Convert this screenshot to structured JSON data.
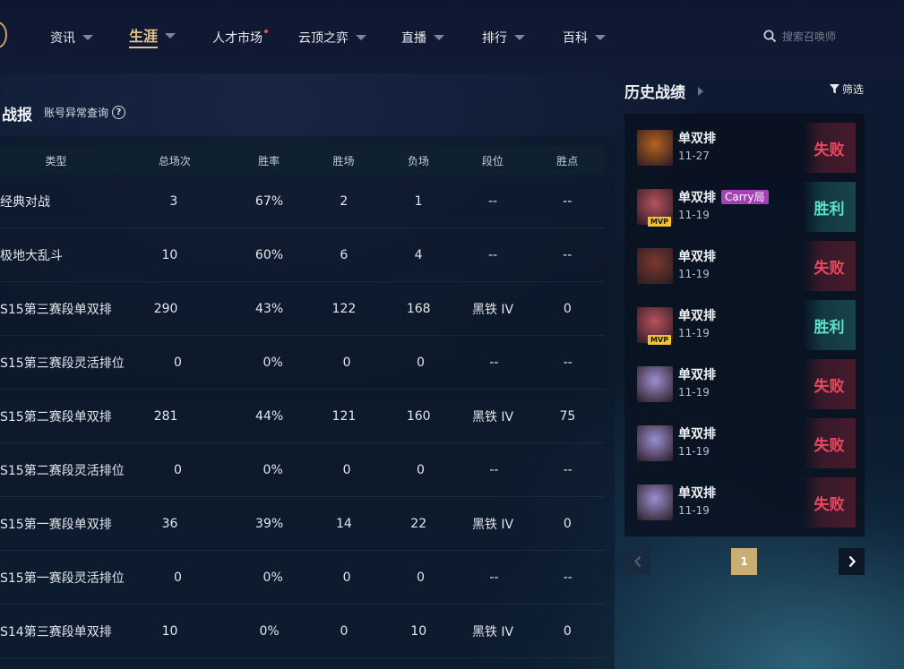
{
  "nav": {
    "items": [
      {
        "label": "资讯",
        "caret": true
      },
      {
        "label": "生涯",
        "caret": true,
        "active": true
      },
      {
        "label": "人才市场",
        "dot": true
      },
      {
        "label": "云顶之弈",
        "caret": true
      },
      {
        "label": "直播",
        "caret": true
      },
      {
        "label": "排行",
        "caret": true
      },
      {
        "label": "百科",
        "caret": true
      }
    ],
    "search_placeholder": "搜索召唤师"
  },
  "stats": {
    "title": "战报",
    "abnormal_link": "账号异常查询",
    "help_symbol": "?",
    "headers": [
      "类型",
      "总场次",
      "胜率",
      "胜场",
      "负场",
      "段位",
      "胜点"
    ],
    "rows": [
      [
        "经典对战",
        "3",
        "67%",
        "2",
        "1",
        "--",
        "--"
      ],
      [
        "极地大乱斗",
        "10",
        "60%",
        "6",
        "4",
        "--",
        "--"
      ],
      [
        "S15第三赛段单双排",
        "290",
        "43%",
        "122",
        "168",
        "黑铁 IV",
        "0"
      ],
      [
        "S15第三赛段灵活排位",
        "0",
        "0%",
        "0",
        "0",
        "--",
        "--"
      ],
      [
        "S15第二赛段单双排",
        "281",
        "44%",
        "121",
        "160",
        "黑铁 IV",
        "75"
      ],
      [
        "S15第二赛段灵活排位",
        "0",
        "0%",
        "0",
        "0",
        "--",
        "--"
      ],
      [
        "S15第一赛段单双排",
        "36",
        "39%",
        "14",
        "22",
        "黑铁 IV",
        "0"
      ],
      [
        "S15第一赛段灵活排位",
        "0",
        "0%",
        "0",
        "0",
        "--",
        "--"
      ],
      [
        "S14第三赛段单双排",
        "10",
        "0%",
        "0",
        "10",
        "黑铁 IV",
        "0"
      ]
    ]
  },
  "history": {
    "title": "历史战绩",
    "filter_label": "筛选",
    "mvp_label": "MVP",
    "matches": [
      {
        "mode": "单双排",
        "date": "11-27",
        "result": "失败",
        "outcome": "lose",
        "mvp": false,
        "carry": "",
        "avatar_color": "#b5621f"
      },
      {
        "mode": "单双排",
        "date": "11-19",
        "result": "胜利",
        "outcome": "win",
        "mvp": true,
        "carry": "Carry局",
        "avatar_color": "#b8525e"
      },
      {
        "mode": "单双排",
        "date": "11-19",
        "result": "失败",
        "outcome": "lose",
        "mvp": false,
        "carry": "",
        "avatar_color": "#7a3a2e"
      },
      {
        "mode": "单双排",
        "date": "11-19",
        "result": "胜利",
        "outcome": "win",
        "mvp": true,
        "carry": "",
        "avatar_color": "#b8525e"
      },
      {
        "mode": "单双排",
        "date": "11-19",
        "result": "失败",
        "outcome": "lose",
        "mvp": false,
        "carry": "",
        "avatar_color": "#9a8fd0"
      },
      {
        "mode": "单双排",
        "date": "11-19",
        "result": "失败",
        "outcome": "lose",
        "mvp": false,
        "carry": "",
        "avatar_color": "#9a8fd0"
      },
      {
        "mode": "单双排",
        "date": "11-19",
        "result": "失败",
        "outcome": "lose",
        "mvp": false,
        "carry": "",
        "avatar_color": "#9a8fd0"
      }
    ],
    "current_page": "1"
  }
}
